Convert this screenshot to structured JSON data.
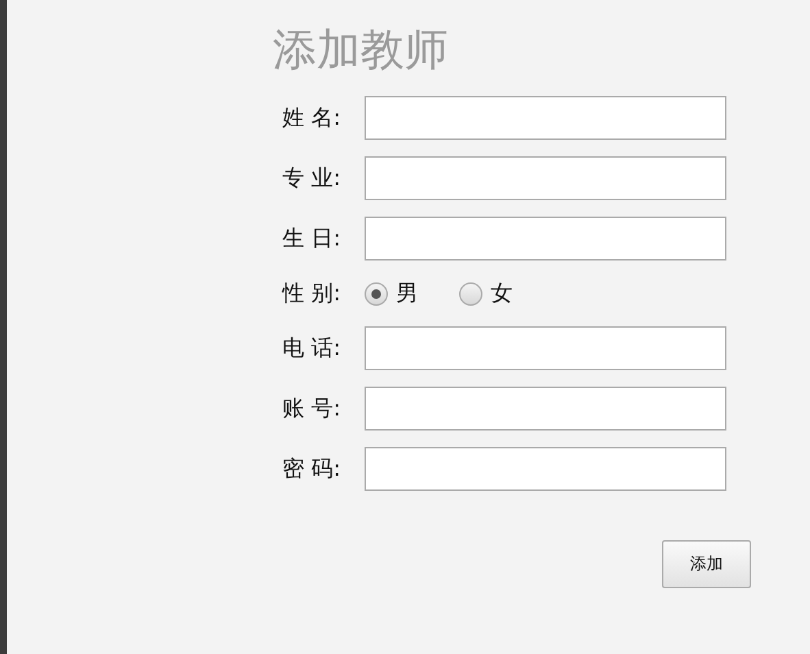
{
  "title": "添加教师",
  "fields": [
    {
      "kind": "text",
      "label": "姓 名:"
    },
    {
      "kind": "text",
      "label": "专 业:"
    },
    {
      "kind": "text",
      "label": "生 日:"
    },
    {
      "kind": "radio",
      "label": "性 别:",
      "options": [
        {
          "label": "男",
          "selected": true
        },
        {
          "label": "女",
          "selected": false
        }
      ]
    },
    {
      "kind": "text",
      "label": "电 话:"
    },
    {
      "kind": "text",
      "label": "账 号:"
    },
    {
      "kind": "text",
      "label": "密 码:"
    }
  ],
  "submit": "添加"
}
